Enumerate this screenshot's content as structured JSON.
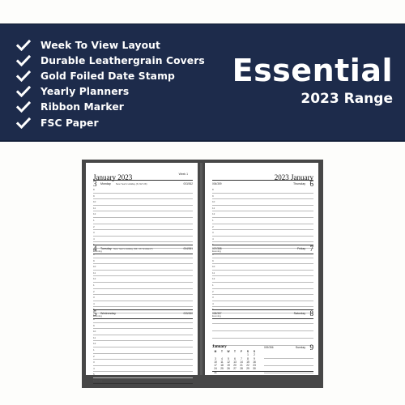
{
  "banner": {
    "features": [
      "Week To View Layout",
      "Durable Leathergrain Covers",
      "Gold Foiled Date Stamp",
      "Yearly Planners",
      "Ribbon Marker",
      "FSC Paper"
    ],
    "feature_icon": "checkmark-icon",
    "title": "Essential",
    "subtitle": "2023 Range",
    "colors": {
      "background": "#1d2b4b",
      "text": "#ffffff"
    }
  },
  "planner": {
    "left_page": {
      "month_title": "January 2023",
      "week_label": "Week 1",
      "days": [
        {
          "num": "3",
          "name": "Monday",
          "holiday": "New Year's Holiday (N, NZ UK)",
          "count": "003/362"
        },
        {
          "num": "4",
          "name": "Tuesday",
          "holiday": "New Year's Holiday (NZ, UK Scotland*)",
          "count": "004/361"
        },
        {
          "num": "5",
          "name": "Wednesday",
          "holiday": "",
          "count": "005/360"
        }
      ]
    },
    "right_page": {
      "month_title": "2023 January",
      "days": [
        {
          "num": "6",
          "name": "Thursday",
          "count": "006/359"
        },
        {
          "num": "7",
          "name": "Friday",
          "count": "007/358"
        },
        {
          "num": "8",
          "name": "Saturday",
          "count": "008/357"
        },
        {
          "num": "9",
          "name": "Sunday",
          "count": "009/356"
        }
      ]
    },
    "hours": [
      "8",
      "9",
      "10",
      "11",
      "12",
      "1",
      "2",
      "3",
      "4",
      "5"
    ],
    "evening_label": "Evening",
    "mini_calendar": {
      "title": "January",
      "weekdays": [
        "M",
        "T",
        "W",
        "T",
        "F",
        "S",
        "S"
      ],
      "cells": [
        "",
        "",
        "",
        "",
        "",
        "1",
        "2",
        "3",
        "4",
        "5",
        "6",
        "7",
        "8",
        "9",
        "10",
        "11",
        "12",
        "13",
        "14",
        "15",
        "16",
        "17",
        "18",
        "19",
        "20",
        "21",
        "22",
        "23",
        "24",
        "25",
        "26",
        "27",
        "28",
        "29",
        "30",
        "31",
        "",
        "",
        "",
        "",
        "",
        ""
      ]
    }
  }
}
